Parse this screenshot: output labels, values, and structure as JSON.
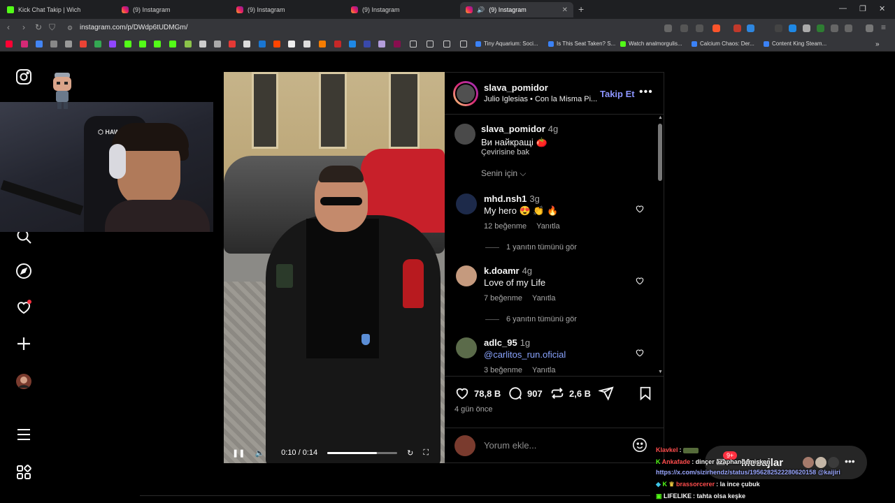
{
  "browser": {
    "tabs": [
      {
        "title": "Kick Chat Takip | Wich",
        "icon": "kick-icon",
        "active": false
      },
      {
        "title": "(9) Instagram",
        "icon": "instagram-icon",
        "active": false
      },
      {
        "title": "(9) Instagram",
        "icon": "instagram-icon",
        "active": false
      },
      {
        "title": "(9) Instagram",
        "icon": "instagram-icon",
        "active": false
      },
      {
        "title": "(9) Instagram",
        "icon": "instagram-icon",
        "active": true
      }
    ],
    "url": "instagram.com/p/DWdp6tUDMGm/",
    "bookmarks": [
      "Tiny Aquarium: Soci...",
      "Is This Seat Taken? S...",
      "Watch analmorgulis...",
      "Calcium Chaos: Der...",
      "Content King Steam..."
    ]
  },
  "post": {
    "username": "slava_pomidor",
    "audio": "Julio Iglesias • Con la Misma Pi...",
    "follow_label": "Takip Et",
    "caption_time": "4g",
    "caption": "Ви найкращі 🍅",
    "translate": "Çevirisine bak",
    "sort_label": "Senin için",
    "likes": "78,8 B",
    "comments_count": "907",
    "reposts": "2,6 B",
    "age": "4 gün önce",
    "add_comment_placeholder": "Yorum ekle...",
    "video": {
      "time": "0:10 / 0:14",
      "progress": 0.71
    }
  },
  "comments": [
    {
      "user": "mhd.nsh1",
      "time": "3g",
      "text": "My hero 😍 👏 🔥",
      "likes": "12 beğenme",
      "reply": "Yanıtla",
      "replies": "1 yanıtın tümünü gör"
    },
    {
      "user": "k.doamr",
      "time": "4g",
      "text": "Love of my Life",
      "likes": "7 beğenme",
      "reply": "Yanıtla",
      "replies": "6 yanıtın tümünü gör"
    },
    {
      "user": "adlc_95",
      "time": "1g",
      "text": "@carlitos_run.oficial",
      "likes": "3 beğenme",
      "reply": "Yanıtla"
    }
  ],
  "messages": {
    "label": "Mesajlar",
    "badge": "9+"
  },
  "chat": [
    {
      "name": "Klavkel",
      "text": ":",
      "color": "#ff4d4d"
    },
    {
      "name": "Ankafade",
      "text": ": dinçer azaphandemişken",
      "color": "#ff4d4d"
    },
    {
      "name": "",
      "text": "https://x.com/sizirhendz/status/1956282522280620158 @kaijiri",
      "color": "#9aa7ff"
    },
    {
      "name": "brassorcerer",
      "text": ": la ince çubuk",
      "color": "#ff4d4d"
    },
    {
      "name": "LIFELIKE",
      "text": ": tahta olsa keşke",
      "color": "#ffffff"
    }
  ]
}
